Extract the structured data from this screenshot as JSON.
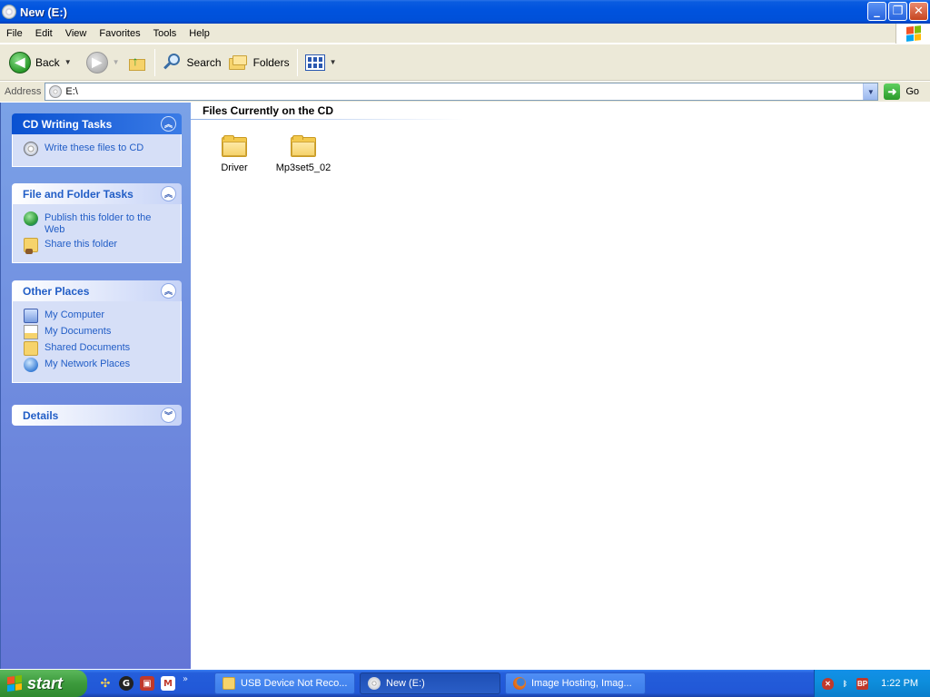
{
  "window": {
    "title": "New (E:)",
    "controls": [
      "minimize",
      "restore",
      "close"
    ]
  },
  "menubar": {
    "items": [
      "File",
      "Edit",
      "View",
      "Favorites",
      "Tools",
      "Help"
    ]
  },
  "toolbar": {
    "back_label": "Back",
    "search_label": "Search",
    "folders_label": "Folders"
  },
  "address": {
    "label": "Address",
    "value": "E:\\",
    "go_label": "Go"
  },
  "taskpane": {
    "cd_tasks": {
      "title": "CD Writing Tasks",
      "items": [
        {
          "label": "Write these files to CD",
          "icon": "cd-write-icon"
        }
      ]
    },
    "file_tasks": {
      "title": "File and Folder Tasks",
      "items": [
        {
          "label": "Publish this folder to the Web",
          "icon": "globe-icon"
        },
        {
          "label": "Share this folder",
          "icon": "share-folder-icon"
        }
      ]
    },
    "other_places": {
      "title": "Other Places",
      "items": [
        {
          "label": "My Computer",
          "icon": "computer-icon"
        },
        {
          "label": "My Documents",
          "icon": "documents-icon"
        },
        {
          "label": "Shared Documents",
          "icon": "folder-icon"
        },
        {
          "label": "My Network Places",
          "icon": "network-icon"
        }
      ]
    },
    "details": {
      "title": "Details"
    }
  },
  "content": {
    "group_title": "Files Currently on the CD",
    "files": [
      {
        "name": "Driver",
        "type": "folder"
      },
      {
        "name": "Mp3set5_02",
        "type": "folder"
      }
    ]
  },
  "taskbar": {
    "start_label": "start",
    "tasks": [
      {
        "label": "USB Device Not Reco...",
        "icon": "folder-icon",
        "active": false
      },
      {
        "label": "New (E:)",
        "icon": "cd-icon",
        "active": true
      },
      {
        "label": "Image Hosting, Imag...",
        "icon": "firefox-icon",
        "active": false
      }
    ],
    "tray_text": "BP",
    "clock": "1:22 PM"
  },
  "colors": {
    "titlebar": "#0053de",
    "taskpane": "#6d8ce0",
    "link": "#215dc6",
    "start": "#3c9a3c"
  }
}
